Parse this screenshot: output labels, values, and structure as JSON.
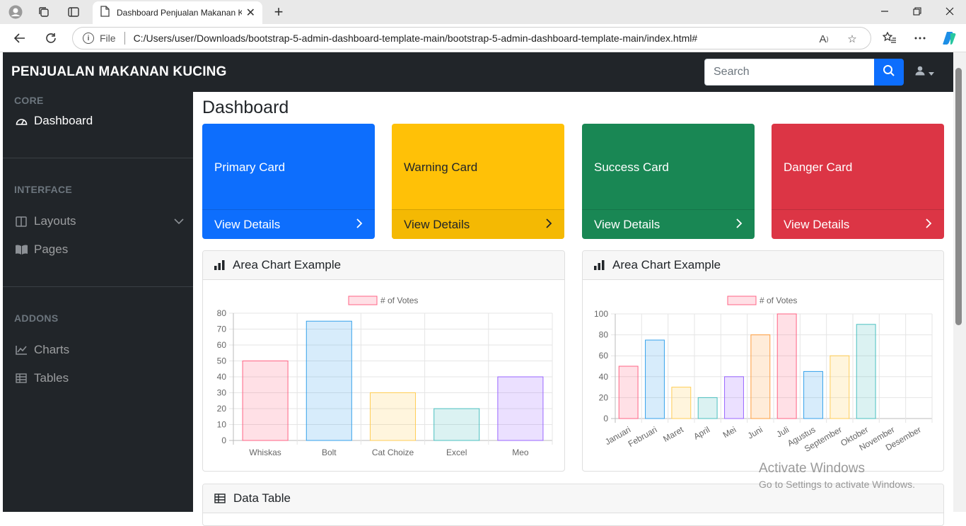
{
  "browser": {
    "tab_title": "Dashboard Penjualan Makanan Kucing",
    "address_label": "File",
    "url": "C:/Users/user/Downloads/bootstrap-5-admin-dashboard-template-main/bootstrap-5-admin-dashboard-template-main/index.html#"
  },
  "navbar": {
    "brand": "PENJUALAN MAKANAN KUCING",
    "search_placeholder": "Search"
  },
  "sidebar": {
    "core_heading": "CORE",
    "dashboard": "Dashboard",
    "interface_heading": "INTERFACE",
    "layouts": "Layouts",
    "pages": "Pages",
    "addons_heading": "ADDONS",
    "charts": "Charts",
    "tables": "Tables"
  },
  "main": {
    "title": "Dashboard",
    "cards": [
      {
        "label": "Primary Card",
        "footer": "View Details",
        "color": "#0d6efd"
      },
      {
        "label": "Warning Card",
        "footer": "View Details",
        "color": "#ffc107"
      },
      {
        "label": "Success Card",
        "footer": "View Details",
        "color": "#198754"
      },
      {
        "label": "Danger Card",
        "footer": "View Details",
        "color": "#dc3545"
      }
    ],
    "chart1_title": "Area Chart Example",
    "chart2_title": "Area Chart Example",
    "table_title": "Data Table"
  },
  "chart_data": [
    {
      "type": "bar",
      "title": "Area Chart Example",
      "legend": "# of Votes",
      "legend_position": "top",
      "categories": [
        "Whiskas",
        "Bolt",
        "Cat Choize",
        "Excel",
        "Meo"
      ],
      "values": [
        50,
        75,
        30,
        20,
        40
      ],
      "ylim": [
        0,
        80
      ],
      "yticks": [
        0,
        10,
        20,
        30,
        40,
        50,
        60,
        70,
        80
      ],
      "grid": true,
      "colors": [
        "#ff6384",
        "#36a2eb",
        "#ffcd56",
        "#4bc0c0",
        "#9966ff"
      ]
    },
    {
      "type": "bar",
      "title": "Area Chart Example",
      "legend": "# of Votes",
      "legend_position": "top",
      "categories": [
        "Januari",
        "Februari",
        "Maret",
        "April",
        "Mei",
        "Juni",
        "Juli",
        "Agustus",
        "September",
        "Oktober",
        "November",
        "Desember"
      ],
      "values": [
        50,
        75,
        30,
        20,
        40,
        80,
        100,
        45,
        60,
        90,
        null,
        null
      ],
      "ylim": [
        0,
        100
      ],
      "yticks": [
        0,
        20,
        40,
        60,
        80,
        100
      ],
      "grid": true,
      "colors": [
        "#ff6384",
        "#36a2eb",
        "#ffcd56",
        "#4bc0c0",
        "#9966ff",
        "#ff9f40",
        "#ff6384",
        "#36a2eb",
        "#ffcd56",
        "#4bc0c0",
        "#9966ff",
        "#ff9f40"
      ]
    }
  ],
  "windows_watermark": {
    "line1": "Activate Windows",
    "line2": "Go to Settings to activate Windows."
  }
}
